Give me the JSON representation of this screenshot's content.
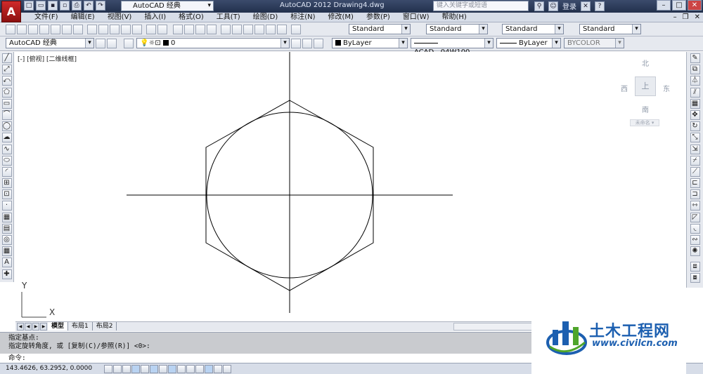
{
  "titlebar": {
    "workspace": "AutoCAD 经典",
    "app_title": "AutoCAD 2012    Drawing4.dwg",
    "search_placeholder": "键入关键字或短语",
    "login": "登录"
  },
  "menu": [
    "文件(F)",
    "编辑(E)",
    "视图(V)",
    "插入(I)",
    "格式(O)",
    "工具(T)",
    "绘图(D)",
    "标注(N)",
    "修改(M)",
    "参数(P)",
    "窗口(W)",
    "帮助(H)"
  ],
  "styles": {
    "text_style": "Standard",
    "dim_style": "Standard",
    "table_style": "Standard",
    "mleader_style": "Standard"
  },
  "layers": {
    "workspace": "AutoCAD 经典",
    "layer": "0",
    "color": "ByLayer",
    "linetype": "ACAD...04W100",
    "lineweight": "ByLayer",
    "plotstyle": "BYCOLOR"
  },
  "viewport": {
    "label": "[-] [俯视] [二维线框]",
    "compass": {
      "north": "北",
      "south": "南",
      "east": "东",
      "west": "西",
      "top": "上"
    },
    "wcs": "未命名 ▾"
  },
  "ucs": {
    "x": "X",
    "y": "Y"
  },
  "tabs": [
    "模型",
    "布局1",
    "布局2"
  ],
  "command": {
    "line1": "指定基点:",
    "line2": "指定旋转角度, 或 [复制(C)/参照(R)] <0>:",
    "prompt": "命令:"
  },
  "status": {
    "coords": "143.4626, 63.2952, 0.0000"
  },
  "watermark": {
    "title": "土木工程网",
    "url": "www.civilcn.com"
  },
  "colors": {
    "titlebar": "#2c3a58",
    "canvas": "#ffffff",
    "watermark": "#1c5fb0",
    "app_logo": "#c02020"
  }
}
